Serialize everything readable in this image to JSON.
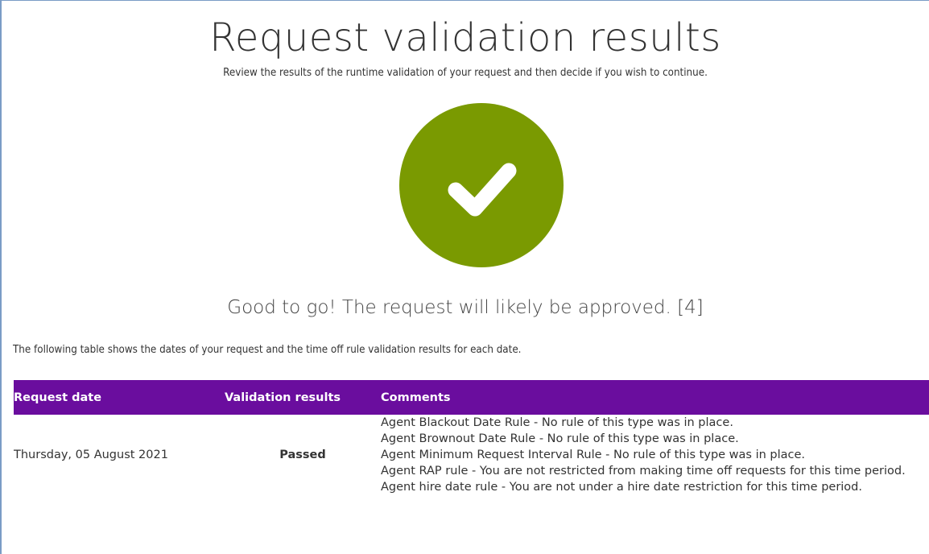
{
  "header": {
    "title": "Request validation results",
    "subtitle": "Review the results of the runtime validation of your request and then decide if you wish to continue."
  },
  "status": {
    "icon": "checkmark-icon",
    "color": "#7a9a01",
    "message": "Good to go! The request will likely be approved. [4]"
  },
  "intro_text": "The following table shows the dates of your request and the time off rule validation results for each date.",
  "table": {
    "header_color": "#6a0d9e",
    "columns": [
      "Request date",
      "Validation results",
      "Comments"
    ],
    "rows": [
      {
        "date": "Thursday, 05 August 2021",
        "result": "Passed",
        "comments": [
          "Agent Blackout Date Rule - No rule of this type was in place.",
          "Agent Brownout Date Rule - No rule of this type was in place.",
          "Agent Minimum Request Interval Rule - No rule of this type was in place.",
          "Agent RAP rule - You are not restricted from making time off requests for this time period.",
          "Agent hire date rule - You are not under a hire date restriction for this time period."
        ]
      }
    ]
  }
}
